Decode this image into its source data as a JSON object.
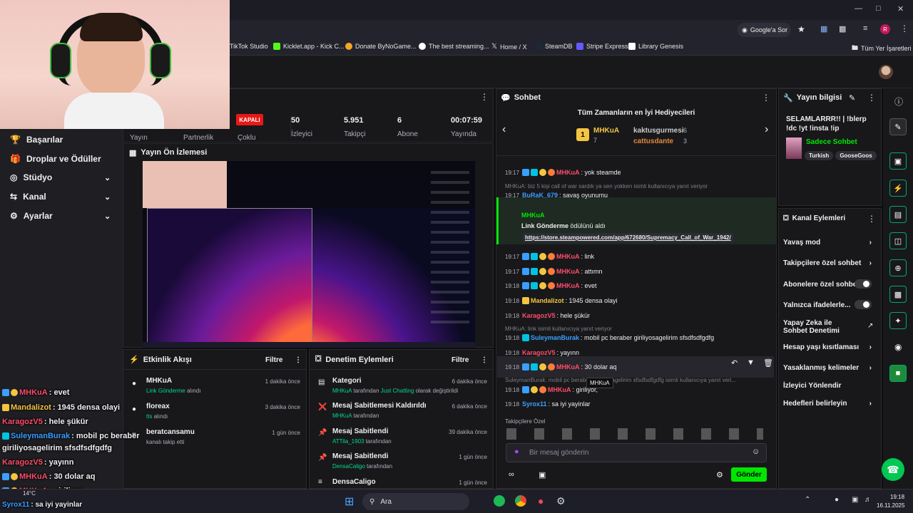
{
  "browser": {
    "search_label": "Google'a Sor",
    "bookmarks": [
      "TikTok Studio",
      "Kicklet.app - Kick C...",
      "Donate ByNoGame...",
      "The best streaming...",
      "Home / X",
      "SteamDB",
      "Stripe Express",
      "Library Genesis"
    ],
    "all_bookmarks": "Tüm Yer İşaretleri"
  },
  "nav": {
    "items": [
      {
        "label": "Başarılar"
      },
      {
        "label": "Droplar ve Ödüller"
      },
      {
        "label": "Stüdyo"
      },
      {
        "label": "Kanal"
      },
      {
        "label": "Ayarlar"
      }
    ]
  },
  "stats": {
    "yayin": "Yayın",
    "partnerlik": "Partnerlik",
    "status_badge": "KAPALI",
    "coklu": "Çoklu",
    "izleyici_value": "50",
    "izleyici_label": "İzleyici",
    "takipci_value": "5.951",
    "takipci_label": "Takipçi",
    "abone_value": "6",
    "abone_label": "Abone",
    "sure_value": "00:07:59",
    "sure_label": "Yayında"
  },
  "preview": {
    "title": "Yayın Ön İzlemesi"
  },
  "activity": {
    "title": "Etkinlik Akışı",
    "filter": "Filtre",
    "events": [
      {
        "name": "MHKuA",
        "detail": "Link Gönderme",
        "detail2": "alındı",
        "time": "1 dakika önce"
      },
      {
        "name": "floreax",
        "detail": "tts",
        "detail2": "alındı",
        "time": "3 dakika önce"
      },
      {
        "name": "beratcansamu",
        "detail": "",
        "detail2": "kanalı takip etti",
        "time": "1 gün önce"
      }
    ]
  },
  "mod": {
    "title": "Denetim Eylemleri",
    "filter": "Filtre",
    "events": [
      {
        "title": "Kategori",
        "user": "MHKuA",
        "mid": "tarafından",
        "cat": "Just Chatting",
        "tail": "olarak değiştirildi",
        "time": "6 dakika önce"
      },
      {
        "title": "Mesaj Sabitlemesi Kaldırıldı",
        "user": "MHKuA",
        "mid": "tarafından",
        "cat": "",
        "tail": "",
        "time": "6 dakika önce"
      },
      {
        "title": "Mesaj Sabitlendi",
        "user": "ATTila_1903",
        "mid": "tarafından",
        "cat": "",
        "tail": "",
        "time": "39 dakika önce"
      },
      {
        "title": "Mesaj Sabitlendi",
        "user": "DensaCaligo",
        "mid": "tarafından",
        "cat": "",
        "tail": "",
        "time": "1 gün önce"
      },
      {
        "title": "DensaCaligo",
        "user": "",
        "mid": "",
        "cat": "",
        "tail": "",
        "time": "1 gün önce"
      }
    ]
  },
  "chat": {
    "title": "Sohbet",
    "top_gifters": "Tüm Zamanların en İyi Hediyecileri",
    "gifters": [
      {
        "name": "MHKuA",
        "count": "7"
      },
      {
        "name": "kaktusgurmesi",
        "count": "6"
      },
      {
        "name": "cattusdante",
        "count": "3"
      }
    ],
    "messages": [
      {
        "time": "19:17",
        "name": "MHKuA",
        "text": ": yok steamde"
      },
      {
        "reply": "MHKuA: biz 5 kişi call of war sardık ya sen yokken isimli kullanıcıya yanıt veriyor"
      },
      {
        "time": "19:17",
        "name": "BuRaK_679",
        "text": ": savaş oyunumu"
      },
      {
        "time": "19:17",
        "name": "MHKuA",
        "text": ": link"
      },
      {
        "time": "19:17",
        "name": "MHKuA",
        "text": ": attımn"
      },
      {
        "time": "19:18",
        "name": "MHKuA",
        "text": ": evet"
      },
      {
        "time": "19:18",
        "name": "Mandalizot",
        "text": ": 1945 densa olayi"
      },
      {
        "time": "19:18",
        "name": "KaragozV5",
        "text": ": hele şükür"
      },
      {
        "reply": "MHKuA: link isimli kullanıcıya yanıt veriyor"
      },
      {
        "time": "19:18",
        "name": "SuleymanBurak",
        "text": ": mobil pc beraber giriliyosagelirim sfsdfsdfgdfg"
      },
      {
        "time": "19:18",
        "name": "KaragozV5",
        "text": ": yayınn"
      },
      {
        "time": "19:18",
        "name": "MHKuA",
        "text": ": 30 dolar aq"
      },
      {
        "reply": "SuleymanBurak: mobil pc beraber giriliyosagelirim sfsdfsdfgdfg isimli kullanıcıya yanıt veri..."
      },
      {
        "time": "19:18",
        "name": "MHKuA",
        "text": ": giriliyor,"
      },
      {
        "time": "19:18",
        "name": "Syrox11",
        "text": ": sa iyi yayinlar"
      }
    ],
    "gift_event": {
      "name": "MHKuA",
      "title": "Link Gönderme",
      "suffix": "ödülünü aldı",
      "url": "https://store.steampowered.com/app/672680/Supremacy_Call_of_War_1942/"
    },
    "tooltip": "MHKuA",
    "followers_only": "Takipçilere Özel",
    "input_placeholder": "Bir mesaj gönderin",
    "send": "Gönder"
  },
  "info": {
    "title": "Yayın bilgisi",
    "stream_title": "SELAMLARRR!! | !blerp !dc !yt !insta !ip",
    "category": "Sadece Sohbet",
    "tags": [
      "Turkish",
      "GooseGoos"
    ]
  },
  "channel_actions": {
    "title": "Kanal Eylemleri",
    "items": [
      {
        "label": "Yavaş mod"
      },
      {
        "label": "Takipçilere özel sohbet"
      },
      {
        "label": "Abonelere özel sohbet"
      },
      {
        "label": "Yalnızca ifadelerle..."
      },
      {
        "label": "Yapay Zeka ile Sohbet Denetimi"
      },
      {
        "label": "Hesap yaşı kısıtlaması"
      },
      {
        "label": "Yasaklanmış kelimeler"
      },
      {
        "label": "İzleyici Yönlendir"
      },
      {
        "label": "Hedefleri belirleyin"
      }
    ]
  },
  "overlay": {
    "lines": [
      {
        "name": "MHKuA",
        "text": ": evet"
      },
      {
        "name": "Mandalizot",
        "text": ": 1945 densa olayi"
      },
      {
        "name": "KaragozV5",
        "text": ": hele şükür"
      },
      {
        "name": "SuleymanBurak",
        "text": ": mobil pc beraber"
      },
      {
        "name": "",
        "text": "giriliyosagelirim sfsdfsdfgdfg"
      },
      {
        "name": "KaragozV5",
        "text": ": yayınn"
      },
      {
        "name": "MHKuA",
        "text": ": 30 dolar aq"
      },
      {
        "name": "MHKuA",
        "text": ": giriliyor,"
      },
      {
        "name": "Syrox11",
        "text": ": sa iyi yayinlar"
      }
    ]
  },
  "taskbar": {
    "search": "Ara",
    "weather": "14°C",
    "time": "19:18",
    "date": "16.11.2025"
  },
  "colors": {
    "accent": "#00e701",
    "red": "#e91916",
    "name_red": "#ff4d6a",
    "name_blue": "#3a9fff",
    "name_yellow": "#f5c542"
  }
}
